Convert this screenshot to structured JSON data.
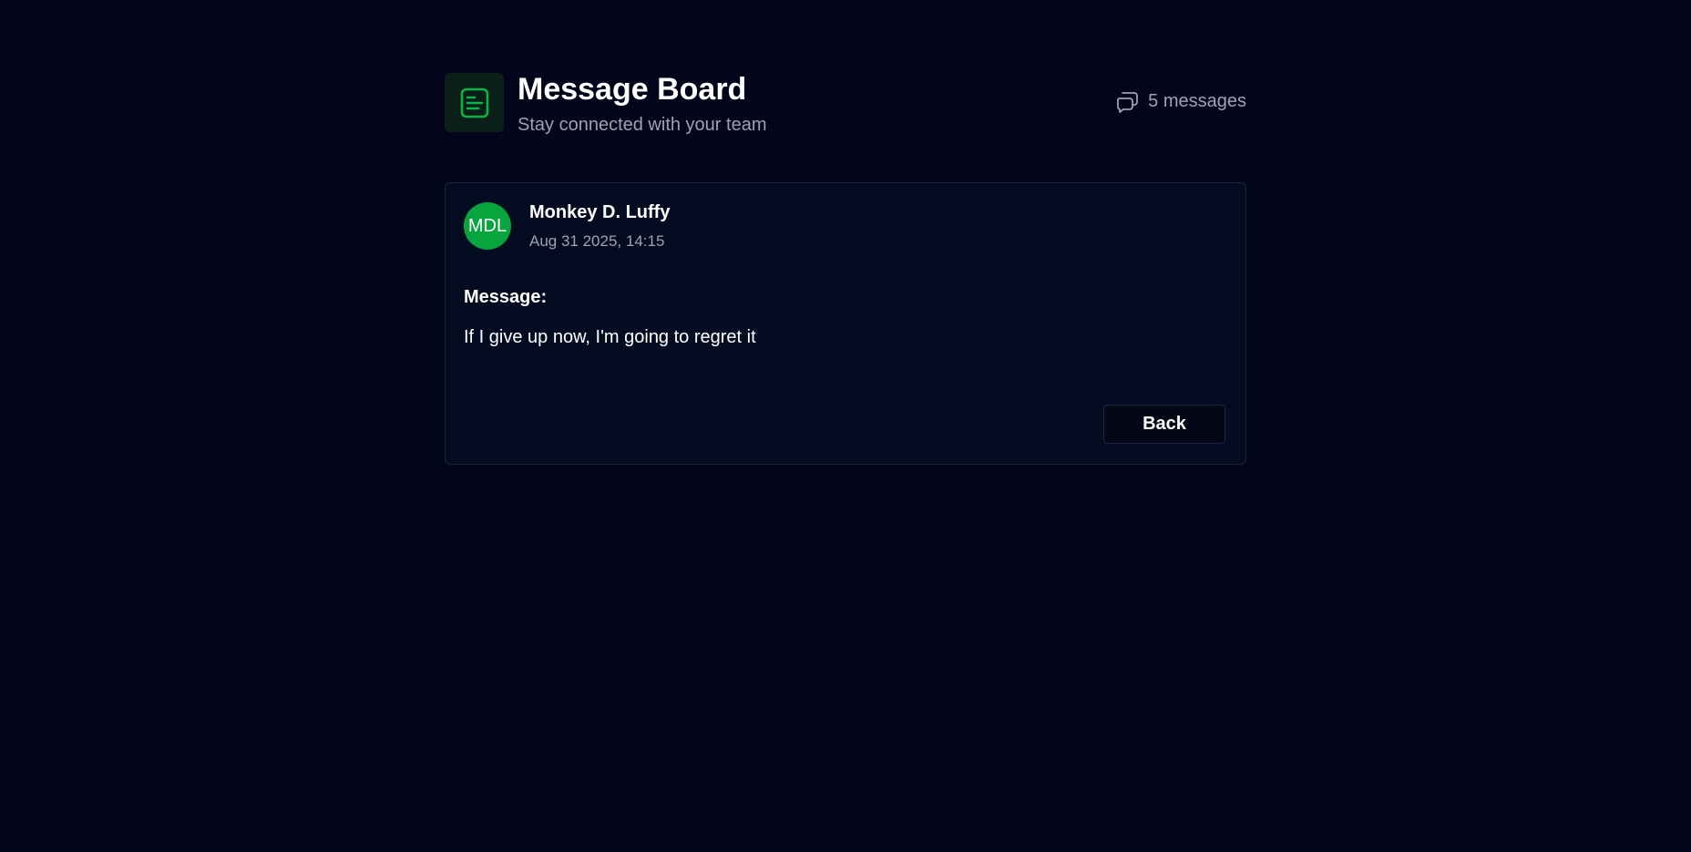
{
  "header": {
    "title": "Message Board",
    "subtitle": "Stay connected with your team",
    "logo_icon": "message-board-icon",
    "count_icon": "chat-bubbles-icon",
    "message_count": "5 messages"
  },
  "message": {
    "avatar_initials": "MDL",
    "author": "Monkey D. Luffy",
    "timestamp": "Aug 31 2025, 14:15",
    "label": "Message:",
    "body": "If I give up now, I'm going to regret it"
  },
  "actions": {
    "back_label": "Back"
  },
  "colors": {
    "background": "#03061a",
    "card": "#040c22",
    "accent": "#08a43e",
    "muted_text": "#9ca3af"
  }
}
